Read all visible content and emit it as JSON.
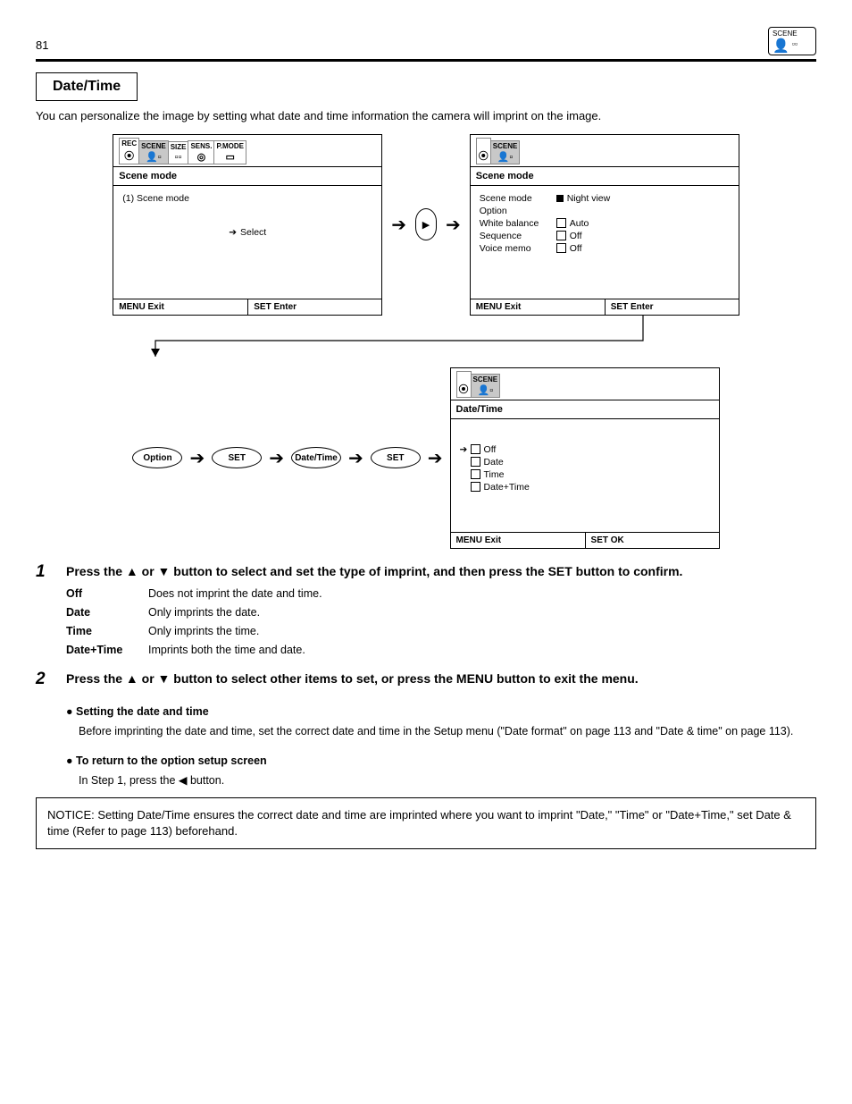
{
  "page_number": "81",
  "header_icon_label": "SCENE",
  "section_title": "Date/Time",
  "intro": "You can personalize the image by setting what date and time information the camera will imprint on the image.",
  "screen_a": {
    "tabs": [
      "REC",
      "SCENE",
      "SIZE",
      "SENS.",
      "P.MODE"
    ],
    "title": "Scene mode",
    "body_line1": "(1) Scene mode",
    "body_select": "Select",
    "foot_left": "MENU Exit",
    "foot_right": "SET Enter"
  },
  "screen_b": {
    "tab": "SCENE",
    "title": "Scene mode",
    "items": [
      {
        "label": "Scene mode",
        "value": "Night view"
      },
      {
        "label": "Option",
        "value": ""
      },
      {
        "label": "White balance",
        "value": "Auto"
      },
      {
        "label": "Sequence",
        "value": "Off"
      },
      {
        "label": "Voice memo",
        "value": "Off"
      }
    ],
    "foot_left": "MENU Exit",
    "foot_right": "SET Enter"
  },
  "pill_path": [
    "Option",
    "SET",
    "Date/Time",
    "SET"
  ],
  "screen_c": {
    "tab": "SCENE",
    "title": "Date/Time",
    "items": [
      "Off",
      "Date",
      "Time",
      "Date+Time"
    ],
    "foot_left": "MENU Exit",
    "foot_right": "SET OK"
  },
  "steps": [
    {
      "num": "1",
      "head": "Press the ▲ or ▼ button to select and set the type of imprint, and then press the SET button to confirm.",
      "rows": [
        {
          "k": "Off",
          "v": "Does not imprint the date and time."
        },
        {
          "k": "Date",
          "v": "Only imprints the date."
        },
        {
          "k": "Time",
          "v": "Only imprints the time."
        },
        {
          "k": "Date+Time",
          "v": "Imprints both the time and date."
        }
      ]
    },
    {
      "num": "2",
      "head": "Press the ▲ or ▼ button to select other items to set, or press the MENU button to exit the menu."
    }
  ],
  "note0": "● Setting the date and time",
  "note0_body": "Before imprinting the date and time, set the correct date and time in the Setup menu (\"Date format\" on page 113 and \"Date & time\" on page 113).",
  "note1": "● To return to the option setup screen",
  "note1_body": "In Step 1, press the ◀ button.",
  "footer_notice": "NOTICE: Setting Date/Time ensures the correct date and time are imprinted where you want to imprint \"Date,\" \"Time\" or \"Date+Time,\" set Date & time (Refer to page 113) beforehand."
}
